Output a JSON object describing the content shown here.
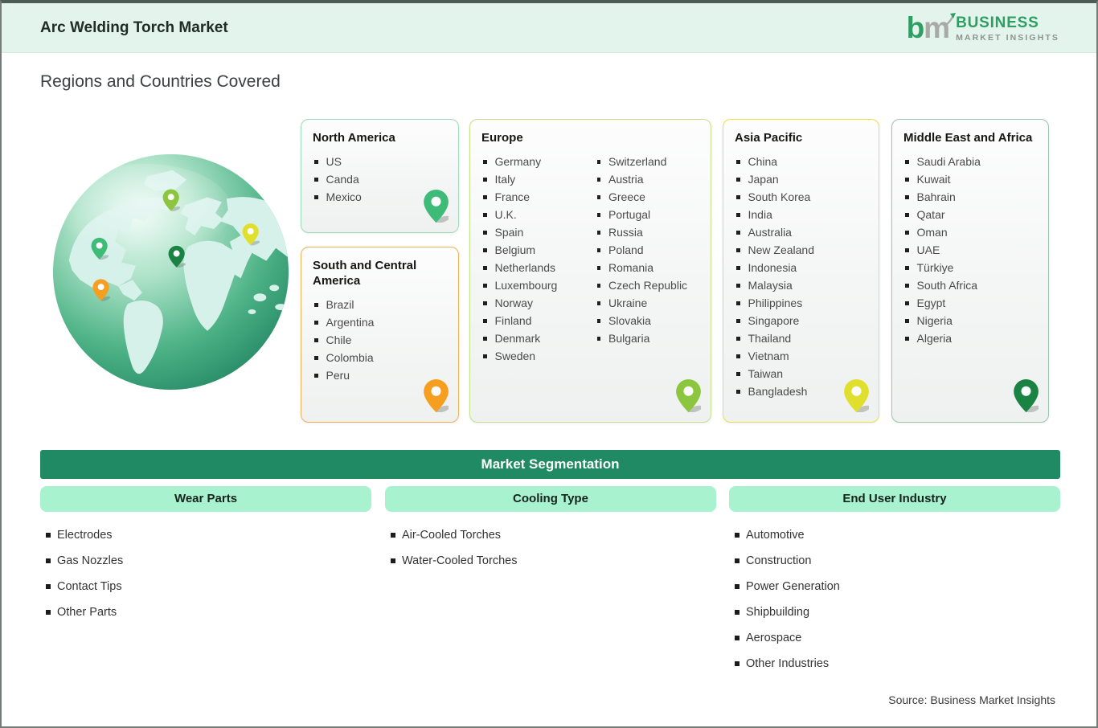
{
  "header": {
    "title": "Arc Welding Torch Market",
    "logo": {
      "mark_b": "b",
      "mark_m": "m",
      "line1": "BUSINESS",
      "line2": "MARKET INSIGHTS",
      "brand_green": "#2f9e63",
      "brand_gray": "#8e938e"
    }
  },
  "section_title": "Regions and Countries Covered",
  "regions": [
    {
      "id": "north-america",
      "name": "North America",
      "countries": [
        "US",
        "Canda",
        "Mexico"
      ],
      "border_color": "#9ddcba",
      "pin_color": "#3dbb77"
    },
    {
      "id": "south-central-america",
      "name": "South and Central America",
      "countries": [
        "Brazil",
        "Argentina",
        "Chile",
        "Colombia",
        "Peru"
      ],
      "border_color": "#f0b054",
      "pin_color": "#f59e1f"
    },
    {
      "id": "europe",
      "name": "Europe",
      "countries": [
        "Germany",
        "Italy",
        "France",
        "U.K.",
        "Spain",
        "Belgium",
        "Netherlands",
        "Luxembourg",
        "Norway",
        "Finland",
        "Denmark",
        "Sweden",
        "Switzerland",
        "Austria",
        "Greece",
        "Portugal",
        "Russia",
        "Poland",
        "Romania",
        "Czech Republic",
        "Ukraine",
        "Slovakia",
        "Bulgaria"
      ],
      "border_color": "#c5e08a",
      "pin_color": "#8cc63f"
    },
    {
      "id": "asia-pacific",
      "name": "Asia Pacific",
      "countries": [
        "China",
        "Japan",
        "South Korea",
        "India",
        "Australia",
        "New Zealand",
        "Indonesia",
        "Malaysia",
        "Philippines",
        "Singapore",
        "Thailand",
        "Vietnam",
        "Taiwan",
        "Bangladesh"
      ],
      "border_color": "#e7e24a",
      "pin_color": "#e0df2e"
    },
    {
      "id": "middle-east-africa",
      "name": "Middle East and Africa",
      "countries": [
        "Saudi Arabia",
        "Kuwait",
        "Bahrain",
        "Qatar",
        "Oman",
        "UAE",
        "Türkiye",
        "South Africa",
        "Egypt",
        "Nigeria",
        "Algeria"
      ],
      "border_color": "#9cc4ae",
      "pin_color": "#1a8243"
    }
  ],
  "segmentation": {
    "title": "Market Segmentation",
    "bar_color": "#1f8a63",
    "pill_color": "#a9f2cf",
    "groups": [
      {
        "id": "wear-parts",
        "name": "Wear Parts",
        "items": [
          "Electrodes",
          "Gas Nozzles",
          "Contact Tips",
          "Other Parts"
        ]
      },
      {
        "id": "cooling-type",
        "name": "Cooling Type",
        "items": [
          "Air-Cooled Torches",
          "Water-Cooled Torches"
        ]
      },
      {
        "id": "end-user-industry",
        "name": "End User Industry",
        "items": [
          "Automotive",
          "Construction",
          "Power Generation",
          "Shipbuilding",
          "Aerospace",
          "Other Industries"
        ]
      }
    ]
  },
  "source": "Source: Business Market Insights"
}
